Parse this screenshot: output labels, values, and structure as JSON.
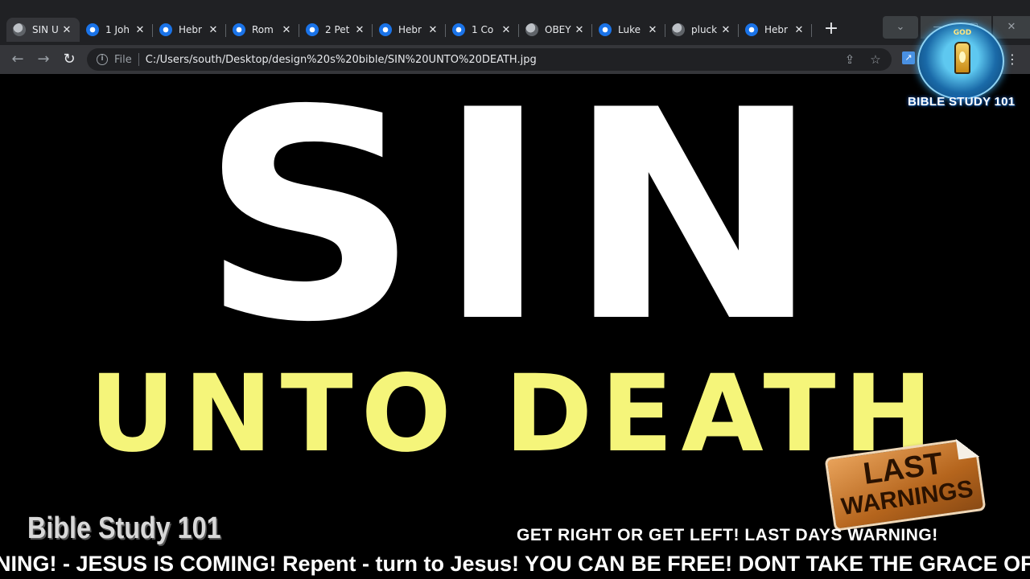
{
  "browser": {
    "tabs": [
      {
        "title": "SIN U",
        "icon": "globe-icon",
        "active": true
      },
      {
        "title": "1 Joh",
        "icon": "bible-site-icon"
      },
      {
        "title": "Hebr",
        "icon": "bible-site-icon"
      },
      {
        "title": "Rom",
        "icon": "bible-site-icon"
      },
      {
        "title": "2 Pet",
        "icon": "bible-site-icon"
      },
      {
        "title": "Hebr",
        "icon": "bible-site-icon"
      },
      {
        "title": "1 Co",
        "icon": "bible-site-icon"
      },
      {
        "title": "OBEY",
        "icon": "globe-icon"
      },
      {
        "title": "Luke",
        "icon": "bible-site-icon"
      },
      {
        "title": "pluck",
        "icon": "globe-icon"
      },
      {
        "title": "Hebr",
        "icon": "bible-site-icon"
      }
    ],
    "tab_close_glyph": "✕",
    "new_tab_glyph": "+",
    "window_controls": {
      "tab_search": "⌄",
      "minimize": "—",
      "maximize": "▢",
      "close": "✕"
    },
    "address": {
      "scheme_label": "File",
      "url": "C:/Users/south/Desktop/design%20s%20bible/SIN%20UNTO%20DEATH.jpg"
    }
  },
  "page": {
    "headline": "SIN",
    "subheadline": "UNTO DEATH",
    "watermark": "Bible Study 101",
    "warning_line": "GET RIGHT OR GET LEFT!  LAST DAYS WARNING!",
    "ticker": "NING! - JESUS IS COMING! Repent - turn to Jesus! YOU CAN BE FREE! DONT TAKE THE GRACE OF",
    "sticker": {
      "line1": "LAST",
      "line2": "WARNINGS"
    },
    "logo": {
      "text": "BIBLE STUDY 101",
      "god_text": "GOD"
    },
    "colors": {
      "headline": "#ffffff",
      "subheadline": "#f5f57a",
      "background": "#000000"
    }
  }
}
